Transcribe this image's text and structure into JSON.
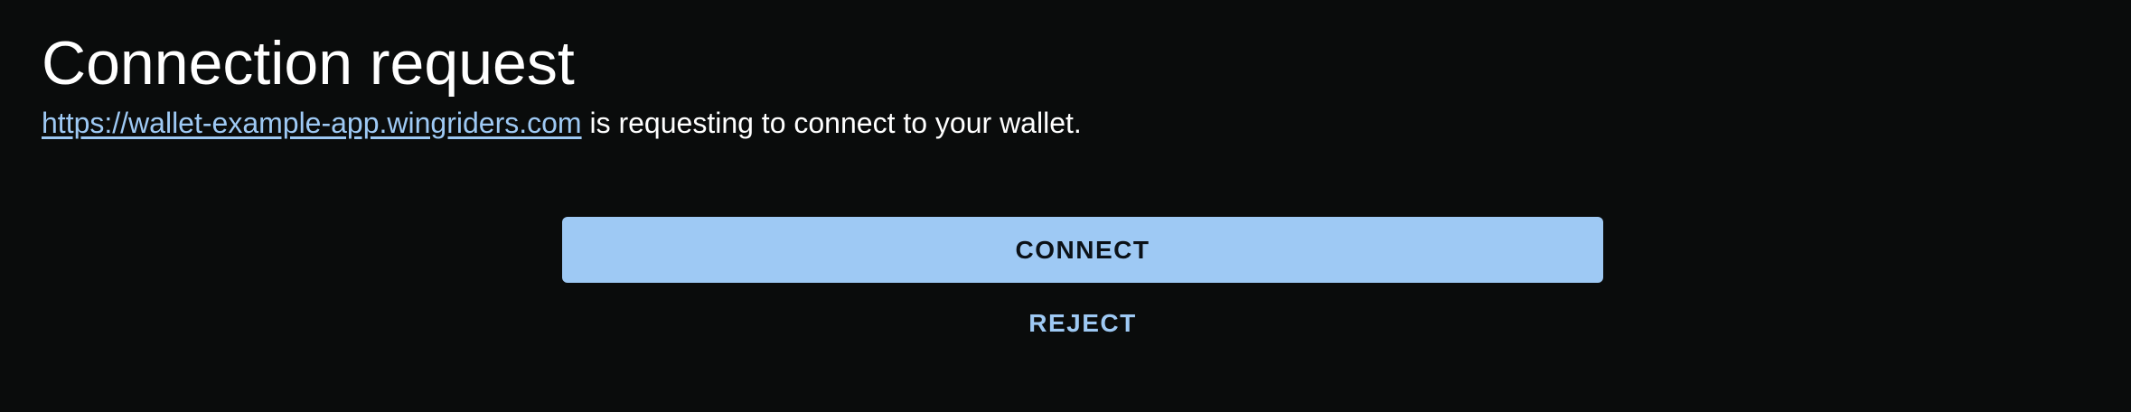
{
  "dialog": {
    "title": "Connection request",
    "origin_url": "https://wallet-example-app.wingriders.com",
    "message": " is requesting to connect to your wallet.",
    "connect_label": "CONNECT",
    "reject_label": "REJECT"
  },
  "colors": {
    "background": "#0a0c0c",
    "accent": "#9ec9f4",
    "text": "#ffffff"
  }
}
